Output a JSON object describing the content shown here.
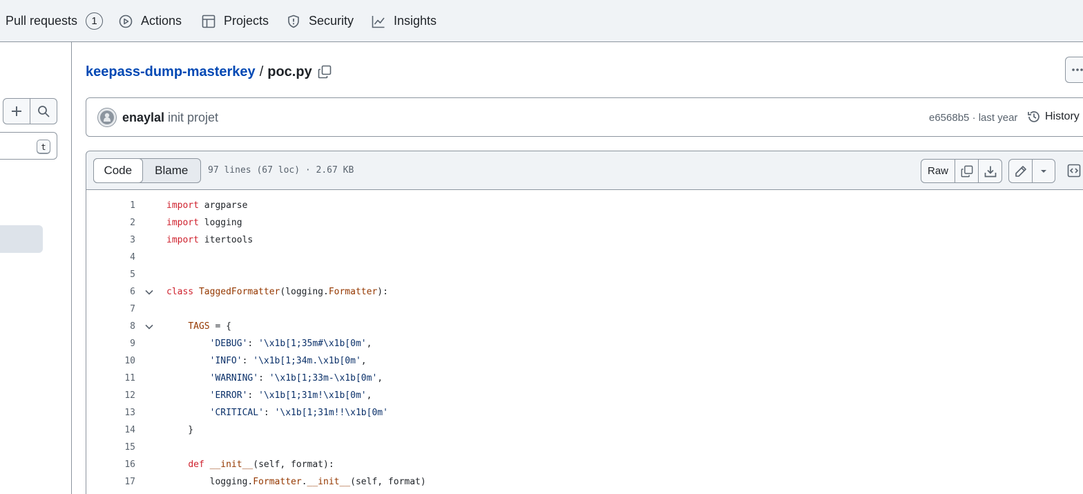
{
  "nav": {
    "items": [
      {
        "label": "Pull requests",
        "icon": "git-pull-request-icon",
        "counter": "1"
      },
      {
        "label": "Actions",
        "icon": "play-icon"
      },
      {
        "label": "Projects",
        "icon": "table-icon"
      },
      {
        "label": "Security",
        "icon": "shield-icon"
      },
      {
        "label": "Insights",
        "icon": "graph-icon"
      }
    ]
  },
  "sidebar": {
    "add_icon": "plus-icon",
    "search_icon": "search-icon",
    "shortcut_key": "t"
  },
  "breadcrumb": {
    "repo": "keepass-dump-masterkey",
    "separator": "/",
    "file": "poc.py"
  },
  "commit": {
    "author": "enaylal",
    "message": "init projet",
    "sha_time": "e6568b5 · last year",
    "history_label": "History"
  },
  "file": {
    "tabs": {
      "code": "Code",
      "blame": "Blame"
    },
    "info": "97 lines (67 loc) · 2.67 KB",
    "raw_label": "Raw"
  },
  "code": {
    "lines": [
      {
        "n": "1",
        "text": "import argparse"
      },
      {
        "n": "2",
        "text": "import logging"
      },
      {
        "n": "3",
        "text": "import itertools"
      },
      {
        "n": "4",
        "text": ""
      },
      {
        "n": "5",
        "text": ""
      },
      {
        "n": "6",
        "text": "class TaggedFormatter(logging.Formatter):",
        "fold": true
      },
      {
        "n": "7",
        "text": ""
      },
      {
        "n": "8",
        "text": "    TAGS = {",
        "fold": true
      },
      {
        "n": "9",
        "text": "        'DEBUG': '\\x1b[1;35m#\\x1b[0m',"
      },
      {
        "n": "10",
        "text": "        'INFO': '\\x1b[1;34m.\\x1b[0m',"
      },
      {
        "n": "11",
        "text": "        'WARNING': '\\x1b[1;33m-\\x1b[0m',"
      },
      {
        "n": "12",
        "text": "        'ERROR': '\\x1b[1;31m!\\x1b[0m',"
      },
      {
        "n": "13",
        "text": "        'CRITICAL': '\\x1b[1;31m!!\\x1b[0m'"
      },
      {
        "n": "14",
        "text": "    }"
      },
      {
        "n": "15",
        "text": ""
      },
      {
        "n": "16",
        "text": "    def __init__(self, format):"
      },
      {
        "n": "17",
        "text": "        logging.Formatter.__init__(self, format)"
      }
    ]
  }
}
